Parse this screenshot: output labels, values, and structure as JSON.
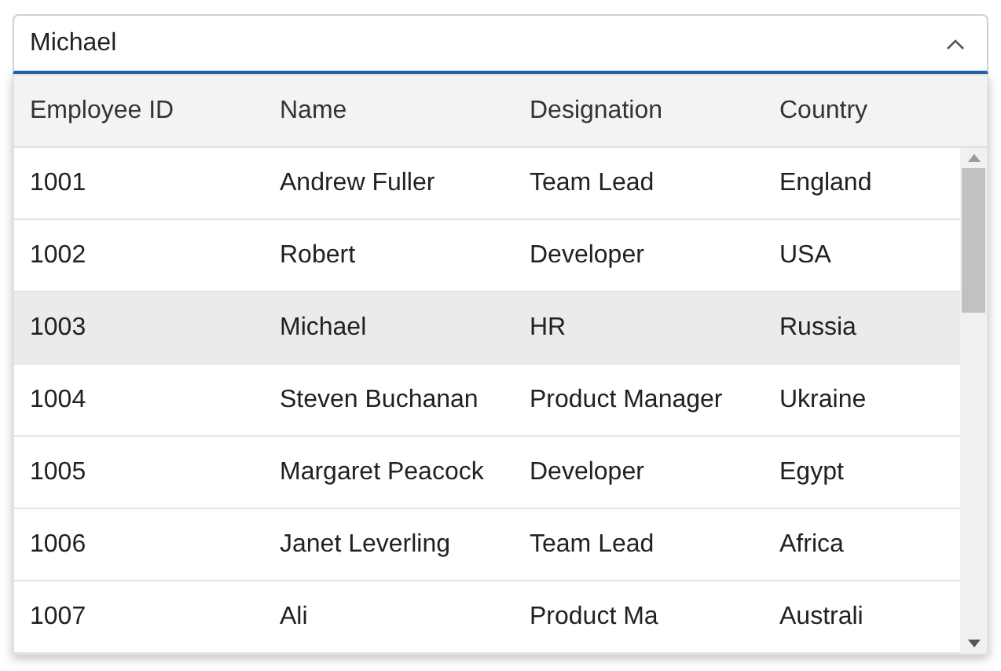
{
  "combo_box": {
    "value": "Michael",
    "expanded": true
  },
  "table": {
    "columns": [
      "Employee ID",
      "Name",
      "Designation",
      "Country"
    ],
    "rows": [
      {
        "cells": [
          "1001",
          "Andrew Fuller",
          "Team Lead",
          "England"
        ],
        "selected": false
      },
      {
        "cells": [
          "1002",
          "Robert",
          "Developer",
          "USA"
        ],
        "selected": false
      },
      {
        "cells": [
          "1003",
          "Michael",
          "HR",
          "Russia"
        ],
        "selected": true
      },
      {
        "cells": [
          "1004",
          "Steven Buchanan",
          "Product Manager",
          "Ukraine"
        ],
        "selected": false
      },
      {
        "cells": [
          "1005",
          "Margaret Peacock",
          "Developer",
          "Egypt"
        ],
        "selected": false
      },
      {
        "cells": [
          "1006",
          "Janet Leverling",
          "Team Lead",
          "Africa"
        ],
        "selected": false
      },
      {
        "cells": [
          "1007",
          "Ali",
          "Product Ma",
          "Australi"
        ],
        "selected": false
      }
    ]
  }
}
